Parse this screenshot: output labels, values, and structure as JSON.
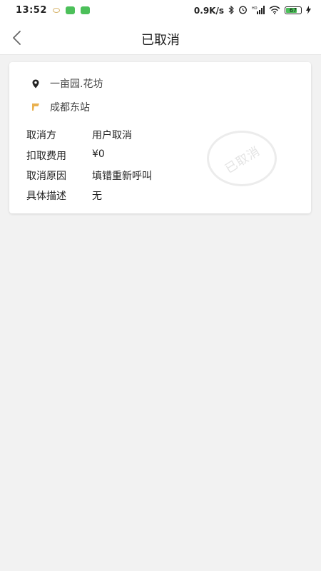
{
  "status_bar": {
    "time": "13:52",
    "net_speed": "0.9K/s",
    "battery_level": "67",
    "icons": [
      "eye-icon",
      "app-notification-icon",
      "app-notification-icon",
      "bluetooth-icon",
      "alarm-icon",
      "hd-signal-icon",
      "wifi-icon",
      "battery-icon",
      "charging-icon"
    ]
  },
  "header": {
    "title": "已取消",
    "back_icon": "chevron-left-icon"
  },
  "trip": {
    "start": "一亩园.花坊",
    "end": "成都东站"
  },
  "details": [
    {
      "label": "取消方",
      "value": "用户取消"
    },
    {
      "label": "扣取费用",
      "value": "¥0"
    },
    {
      "label": "取消原因",
      "value": "填错重新呼叫"
    },
    {
      "label": "具体描述",
      "value": "无"
    }
  ],
  "stamp": {
    "text": "已取消"
  },
  "colors": {
    "background": "#f2f2f2",
    "card": "#ffffff",
    "start_icon": "#222222",
    "end_icon": "#e9b150",
    "battery": "#4cc05a"
  }
}
